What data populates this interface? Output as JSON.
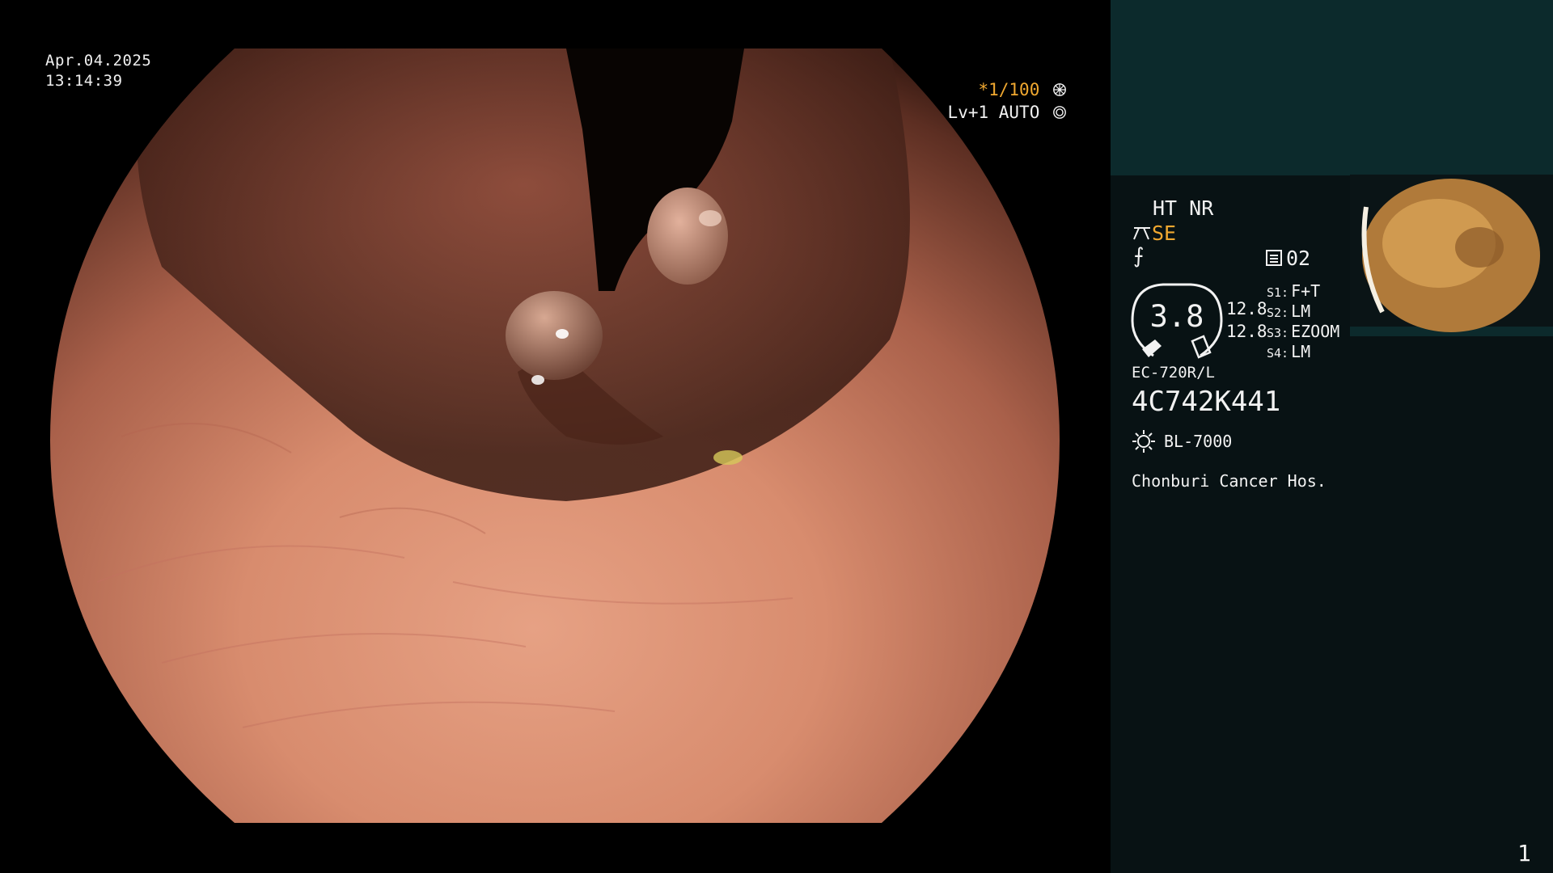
{
  "image_overlay": {
    "date": "Apr.04.2025",
    "time": "13:14:39",
    "shutter": "*1/100",
    "level": "Lv+1 AUTO"
  },
  "side_panel": {
    "ht_nr": "HT NR",
    "se": "SE",
    "slot_label": "02",
    "gauge_value": "3.8",
    "gauge_side_1": "12.8",
    "gauge_side_2": "12.8",
    "switches": [
      {
        "key": "S1:",
        "value": "F+T"
      },
      {
        "key": "S2:",
        "value": "LM"
      },
      {
        "key": "S3:",
        "value": "EZOOM"
      },
      {
        "key": "S4:",
        "value": "LM"
      }
    ],
    "scope_model": "EC-720R/L",
    "scope_serial": "4C742K441",
    "light_source": "BL-7000",
    "hospital": "Chonburi Cancer Hos.",
    "page_number": "1"
  },
  "colors": {
    "background": "#000000",
    "panel_dark": "#081214",
    "panel_top": "#0c2a2c",
    "accent_orange": "#f0a830",
    "text": "#f2f2f2"
  },
  "icons": [
    "shutter-icon",
    "auto-iris-icon",
    "scissors-icon",
    "slot-icon",
    "light-icon",
    "gauge-icon"
  ]
}
